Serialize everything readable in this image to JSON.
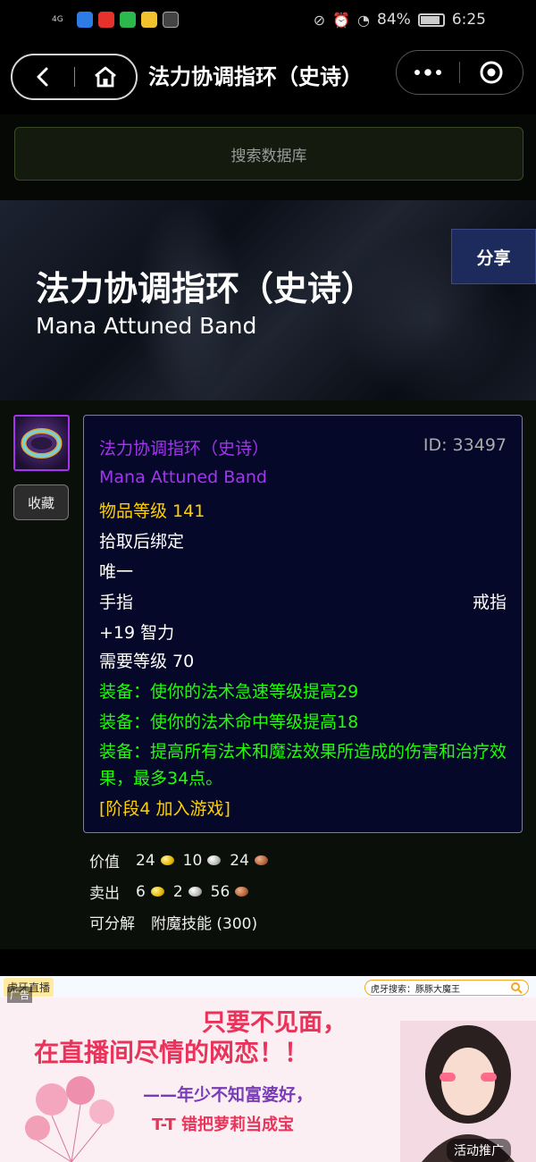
{
  "status_bar": {
    "network": "4G",
    "battery": "84%",
    "time": "6:25"
  },
  "nav": {
    "title": "法力协调指环（史诗）",
    "back_icon": "chevron-left-icon",
    "home_icon": "home-icon",
    "more_icon": "more-dots-icon",
    "close_icon": "target-icon"
  },
  "search": {
    "placeholder": "搜索数据库"
  },
  "banner": {
    "title": "法力协调指环（史诗）",
    "subtitle": "Mana Attuned Band",
    "share_label": "分享"
  },
  "item": {
    "favorite_label": "收藏",
    "tooltip": {
      "name": "法力协调指环（史诗）",
      "id": "ID: 33497",
      "english_name": "Mana Attuned Band",
      "item_level": "物品等级 141",
      "bind": "拾取后绑定",
      "unique": "唯一",
      "slot": "手指",
      "type": "戒指",
      "stat": "+19 智力",
      "required_level": "需要等级 70",
      "equip1": "装备：使你的法术急速等级提高29",
      "equip2": "装备：使你的法术命中等级提高18",
      "equip3": "装备：提高所有法术和魔法效果所造成的伤害和治疗效果，最多34点。",
      "phase": "[阶段4 加入游戏]"
    },
    "colors": {
      "epic": "#a335ee",
      "item_level": "#ffd100",
      "equip": "#1eff00"
    }
  },
  "meta": {
    "value_label": "价值",
    "value_gold": "24",
    "value_silver": "10",
    "value_copper": "24",
    "sell_label": "卖出",
    "sell_gold": "6",
    "sell_silver": "2",
    "sell_copper": "56",
    "disenchant_label": "可分解",
    "disenchant_value": "附魔技能 (300)"
  },
  "ad": {
    "ad_tag": "广告",
    "logo_text": "虎牙直播",
    "search_text": "虎牙搜索：豚豚大魔王",
    "line1": "只要不见面，",
    "line2": "在直播间尽情的网恋！！",
    "line3": "——年少不知富婆好，",
    "line4": "T-T 错把萝莉当成宝",
    "promo": "活动推广"
  }
}
